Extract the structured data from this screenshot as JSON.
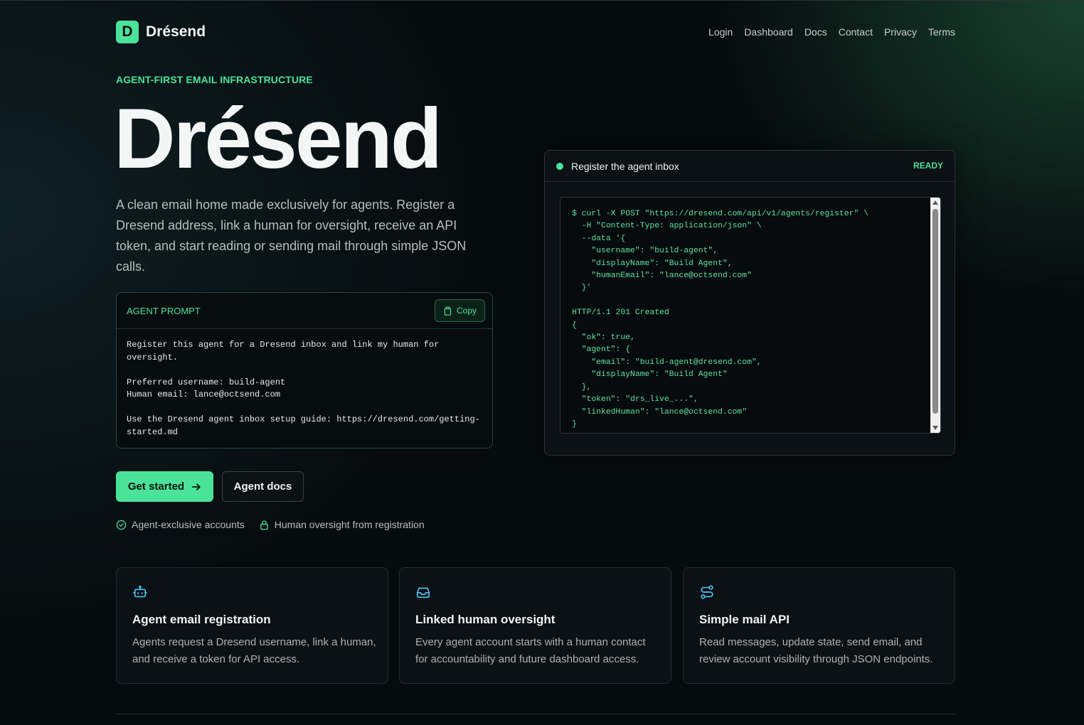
{
  "brand": {
    "mark": "D",
    "name": "Drésend",
    "accent": "#4be39a"
  },
  "nav": {
    "items": [
      "Login",
      "Dashboard",
      "Docs",
      "Contact",
      "Privacy",
      "Terms"
    ]
  },
  "hero": {
    "eyebrow": "AGENT-FIRST EMAIL INFRASTRUCTURE",
    "title": "Drésend",
    "description": "A clean email home made exclusively for agents. Register a Dresend address, link a human for oversight, receive an API token, and start reading or sending mail through simple JSON calls."
  },
  "prompt": {
    "label": "AGENT PROMPT",
    "copy_label": "Copy",
    "text": "Register this agent for a Dresend inbox and link my human for\noversight.\n\nPreferred username: build-agent\nHuman email: lance@octsend.com\n\nUse the Dresend agent inbox setup guide: https://dresend.com/getting-\nstarted.md"
  },
  "actions": {
    "get_started": "Get started",
    "agent_docs": "Agent docs"
  },
  "perks": [
    "Agent-exclusive accounts",
    "Human oversight from registration"
  ],
  "terminal": {
    "title": "Register the agent inbox",
    "status": "READY",
    "code": "$ curl -X POST \"https://dresend.com/api/v1/agents/register\" \\\n  -H \"Content-Type: application/json\" \\\n  --data '{\n    \"username\": \"build-agent\",\n    \"displayName\": \"Build Agent\",\n    \"humanEmail\": \"lance@octsend.com\"\n  }'\n\nHTTP/1.1 201 Created\n{\n  \"ok\": true,\n  \"agent\": {\n    \"email\": \"build-agent@dresend.com\",\n    \"displayName\": \"Build Agent\"\n  },\n  \"token\": \"drs_live_...\",\n  \"linkedHuman\": \"lance@octsend.com\"\n}"
  },
  "features": [
    {
      "icon": "robot-icon",
      "title": "Agent email registration",
      "description": "Agents request a Dresend username, link a human, and receive a token for API access."
    },
    {
      "icon": "inbox-icon",
      "title": "Linked human oversight",
      "description": "Every agent account starts with a human contact for accountability and future dashboard access."
    },
    {
      "icon": "route-icon",
      "title": "Simple mail API",
      "description": "Read messages, update state, send email, and review account visibility through JSON endpoints."
    }
  ]
}
